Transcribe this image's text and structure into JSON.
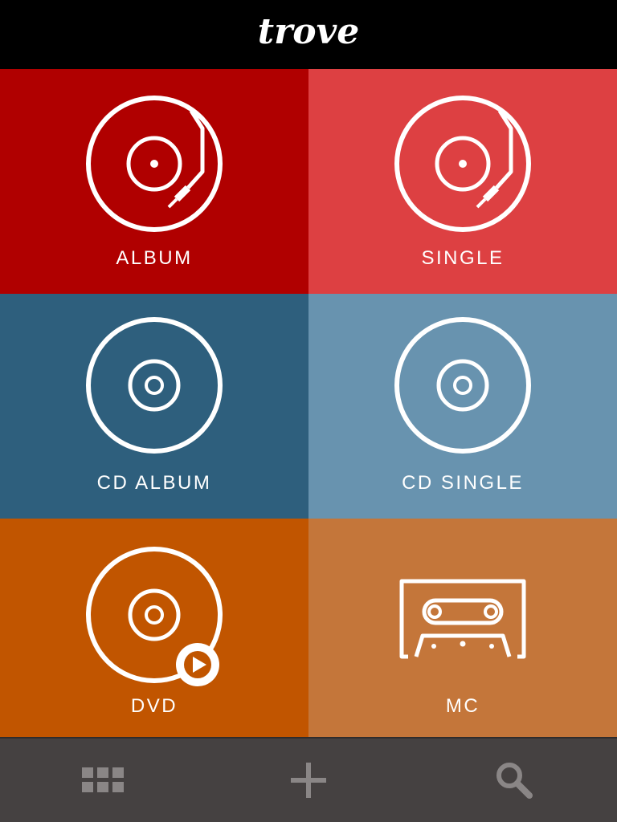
{
  "header": {
    "logo_text": "trove"
  },
  "tiles": [
    {
      "label": "ALBUM",
      "color": "#b00000",
      "icon": "vinyl-turntable-icon"
    },
    {
      "label": "SINGLE",
      "color": "#dd4042",
      "icon": "vinyl-turntable-icon"
    },
    {
      "label": "CD ALBUM",
      "color": "#2e5f7d",
      "icon": "cd-disc-icon"
    },
    {
      "label": "CD SINGLE",
      "color": "#6893af",
      "icon": "cd-disc-icon"
    },
    {
      "label": "DVD",
      "color": "#c15500",
      "icon": "dvd-play-icon"
    },
    {
      "label": "MC",
      "color": "#c4763a",
      "icon": "cassette-icon"
    }
  ],
  "tab_bar": {
    "background": "#454141",
    "icon_color": "#8a8686",
    "items": [
      {
        "icon": "grid-icon"
      },
      {
        "icon": "plus-icon"
      },
      {
        "icon": "search-icon"
      }
    ]
  }
}
